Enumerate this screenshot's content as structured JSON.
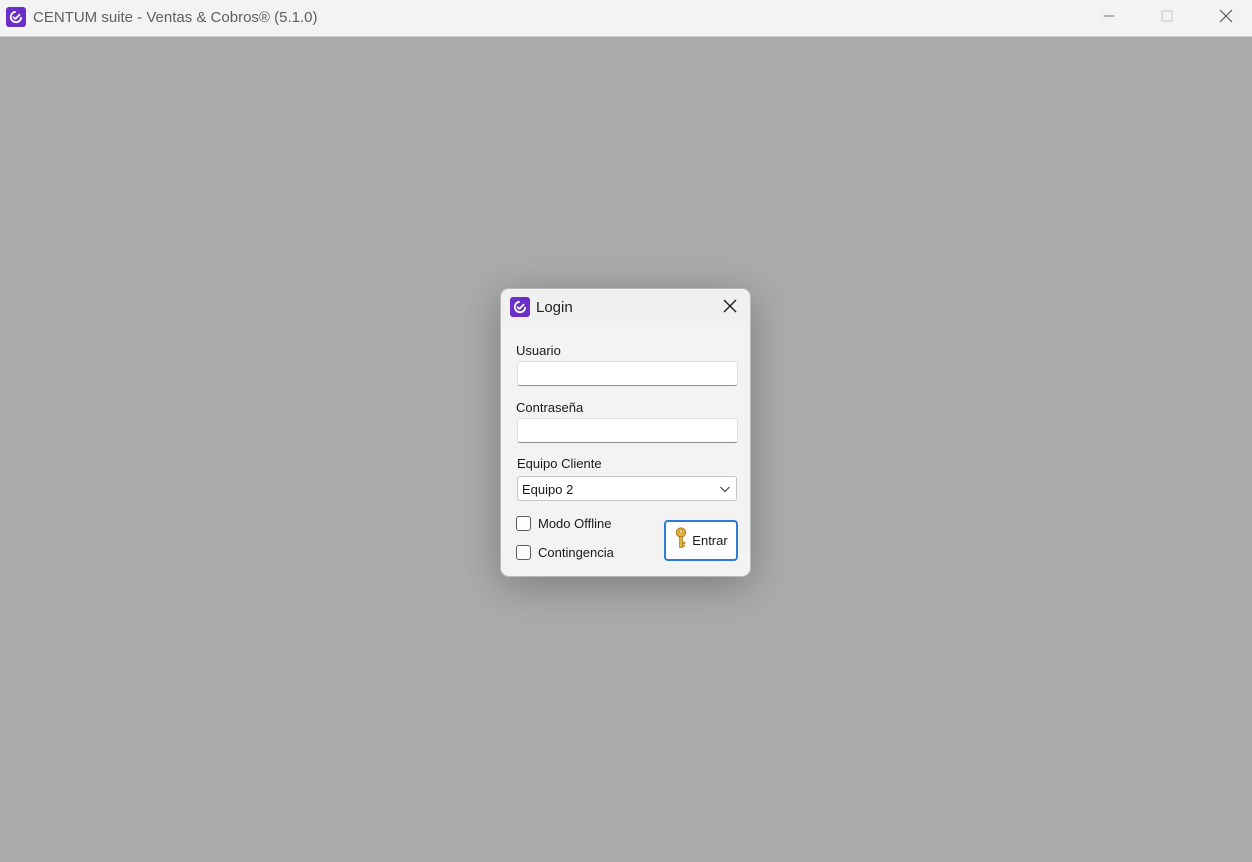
{
  "window": {
    "title": "CENTUM suite - Ventas & Cobros® (5.1.0)",
    "icon": "centum-logo-icon",
    "controls": [
      "minimize-icon",
      "maximize-icon",
      "close-icon"
    ],
    "background_color": "#ababab"
  },
  "login_dialog": {
    "title": "Login",
    "icon": "centum-logo-icon",
    "user": {
      "label": "Usuario",
      "value": "",
      "placeholder": ""
    },
    "password": {
      "label": "Contraseña",
      "value": "",
      "placeholder": ""
    },
    "client_device": {
      "label": "Equipo Cliente",
      "selected": "Equipo 2"
    },
    "offline_mode": {
      "label": "Modo Offline",
      "checked": false
    },
    "contingency": {
      "label": "Contingencia",
      "checked": false
    },
    "enter_button": {
      "label": "Entrar",
      "icon": "key-icon"
    }
  },
  "colors": {
    "brand": "#6a2fc9",
    "accent": "#2e7bd1"
  }
}
